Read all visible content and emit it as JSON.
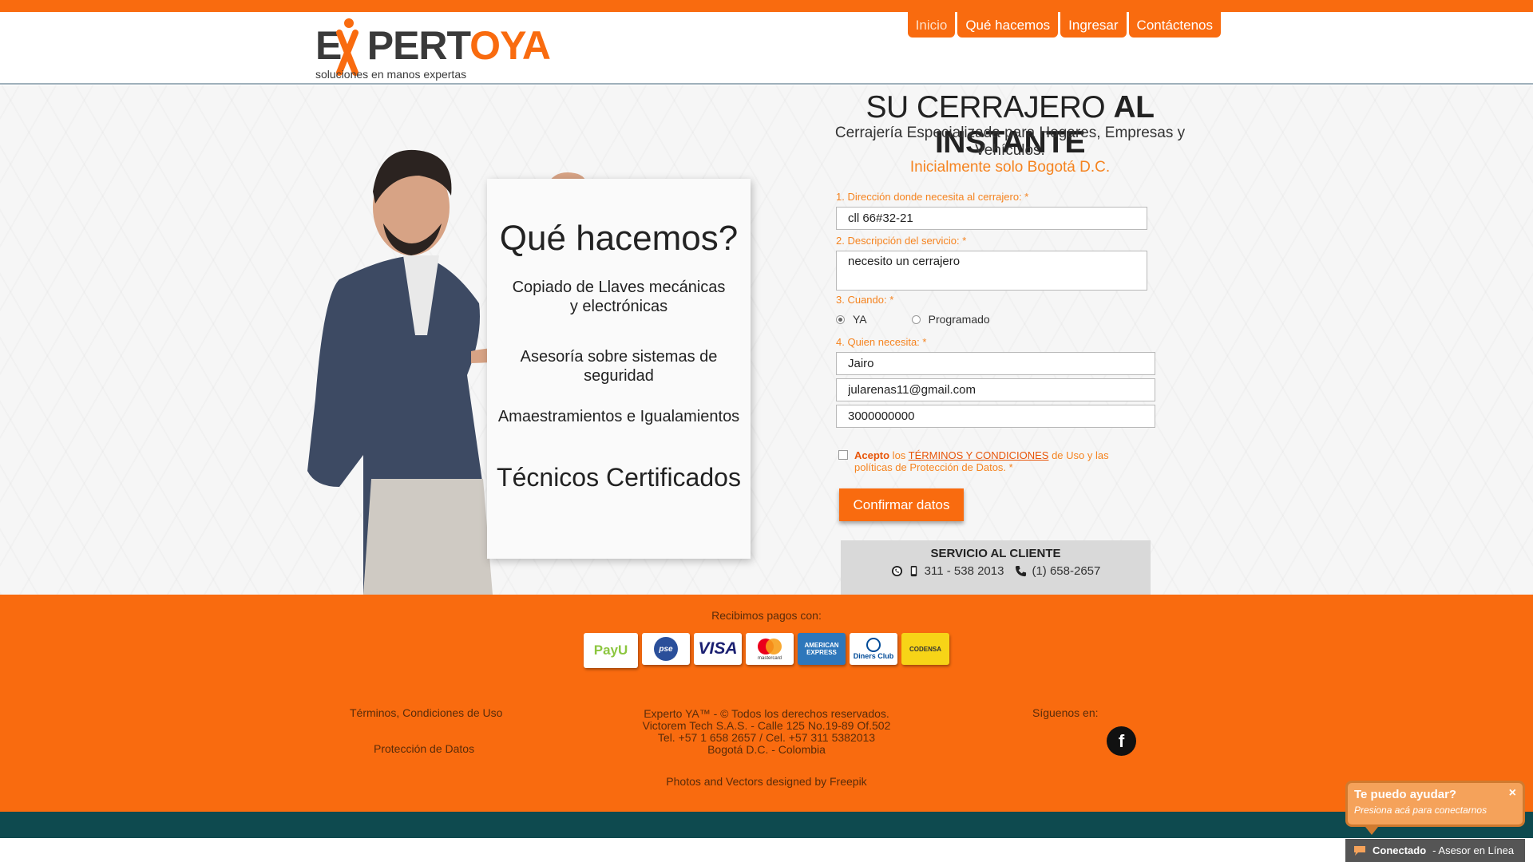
{
  "header": {
    "logo": {
      "brand_left": "E",
      "brand_x": "X",
      "brand_right": "PERT",
      "brand_o": "O",
      "brand_ya": "YA",
      "tagline": "soluciones en manos expertas"
    },
    "nav": [
      {
        "label": "Inicio",
        "active": true
      },
      {
        "label": "Qué hacemos",
        "active": false
      },
      {
        "label": "Ingresar",
        "active": false
      },
      {
        "label": "Contáctenos",
        "active": false
      }
    ]
  },
  "hero": {
    "board": {
      "title": "Qué hacemos?",
      "item_1_line1": "Copiado de Llaves mecánicas",
      "item_1_line2": "y electrónicas",
      "item_2": "Asesoría sobre sistemas de seguridad",
      "item_3": "Amaestramientos e Igualamientos",
      "item_4": "Técnicos Certificados"
    },
    "title_light": "SU CERRAJERO",
    "title_bold": "AL INSTANTE",
    "subtitle": "Cerrajería Especializada para Hogares, Empresas y Vehículos.",
    "city_note": "Inicialmente solo Bogotá D.C."
  },
  "form": {
    "address_label": "1. Dirección donde necesita al cerrajero: *",
    "address_value": "cll 66#32-21",
    "description_label": "2. Descripción del servicio: *",
    "description_value": "necesito un cerrajero",
    "when_label": "3. Cuando: *",
    "when_options": [
      {
        "label": "YA",
        "selected": true
      },
      {
        "label": "Programado",
        "selected": false
      }
    ],
    "who_label": "4. Quien necesita: *",
    "name_value": "Jairo",
    "email_value": "jularenas11@gmail.com",
    "phone_value": "3000000000",
    "terms": {
      "accept": "Acepto",
      "pre": " los ",
      "link": "TÉRMINOS Y CONDICIONES",
      "post": " de Uso y las políticas de Protección de Datos. *"
    },
    "confirm_label": "Confirmar datos"
  },
  "service": {
    "title": "SERVICIO AL CLIENTE",
    "mobile": "311 - 538 2013",
    "landline": "(1) 658-2657"
  },
  "footer": {
    "payments_title": "Recibimos pagos con:",
    "payment_methods": [
      "PayU",
      "pse",
      "VISA",
      "mastercard",
      "AMERICAN EXPRESS",
      "Diners Club",
      "CODENSA"
    ],
    "link_terms": "Términos, Condiciones de Uso",
    "link_privacy": "Protección de Datos",
    "copyright_1": "Experto YA™ - © Todos los derechos reservados.",
    "copyright_2": "Victorem Tech S.A.S. - Calle 125 No.19-89 Of.502",
    "copyright_3": "Tel. +57 1 658 2657 / Cel. +57 311 5382013",
    "copyright_4": "Bogotá D.C. - Colombia",
    "credits": "Photos and Vectors designed by Freepik",
    "follow_label": "Síguenos en:",
    "facebook_letter": "f"
  },
  "chat": {
    "question": "Te puedo ayudar?",
    "hint": "Presiona acá para conectarnos",
    "close": "×",
    "status": "Conectado",
    "agent": "- Asesor en Línea"
  },
  "colors": {
    "brand_orange": "#f96b0f",
    "accent_orange_text": "#f5831f",
    "footer_dark": "#0e4a4f"
  }
}
